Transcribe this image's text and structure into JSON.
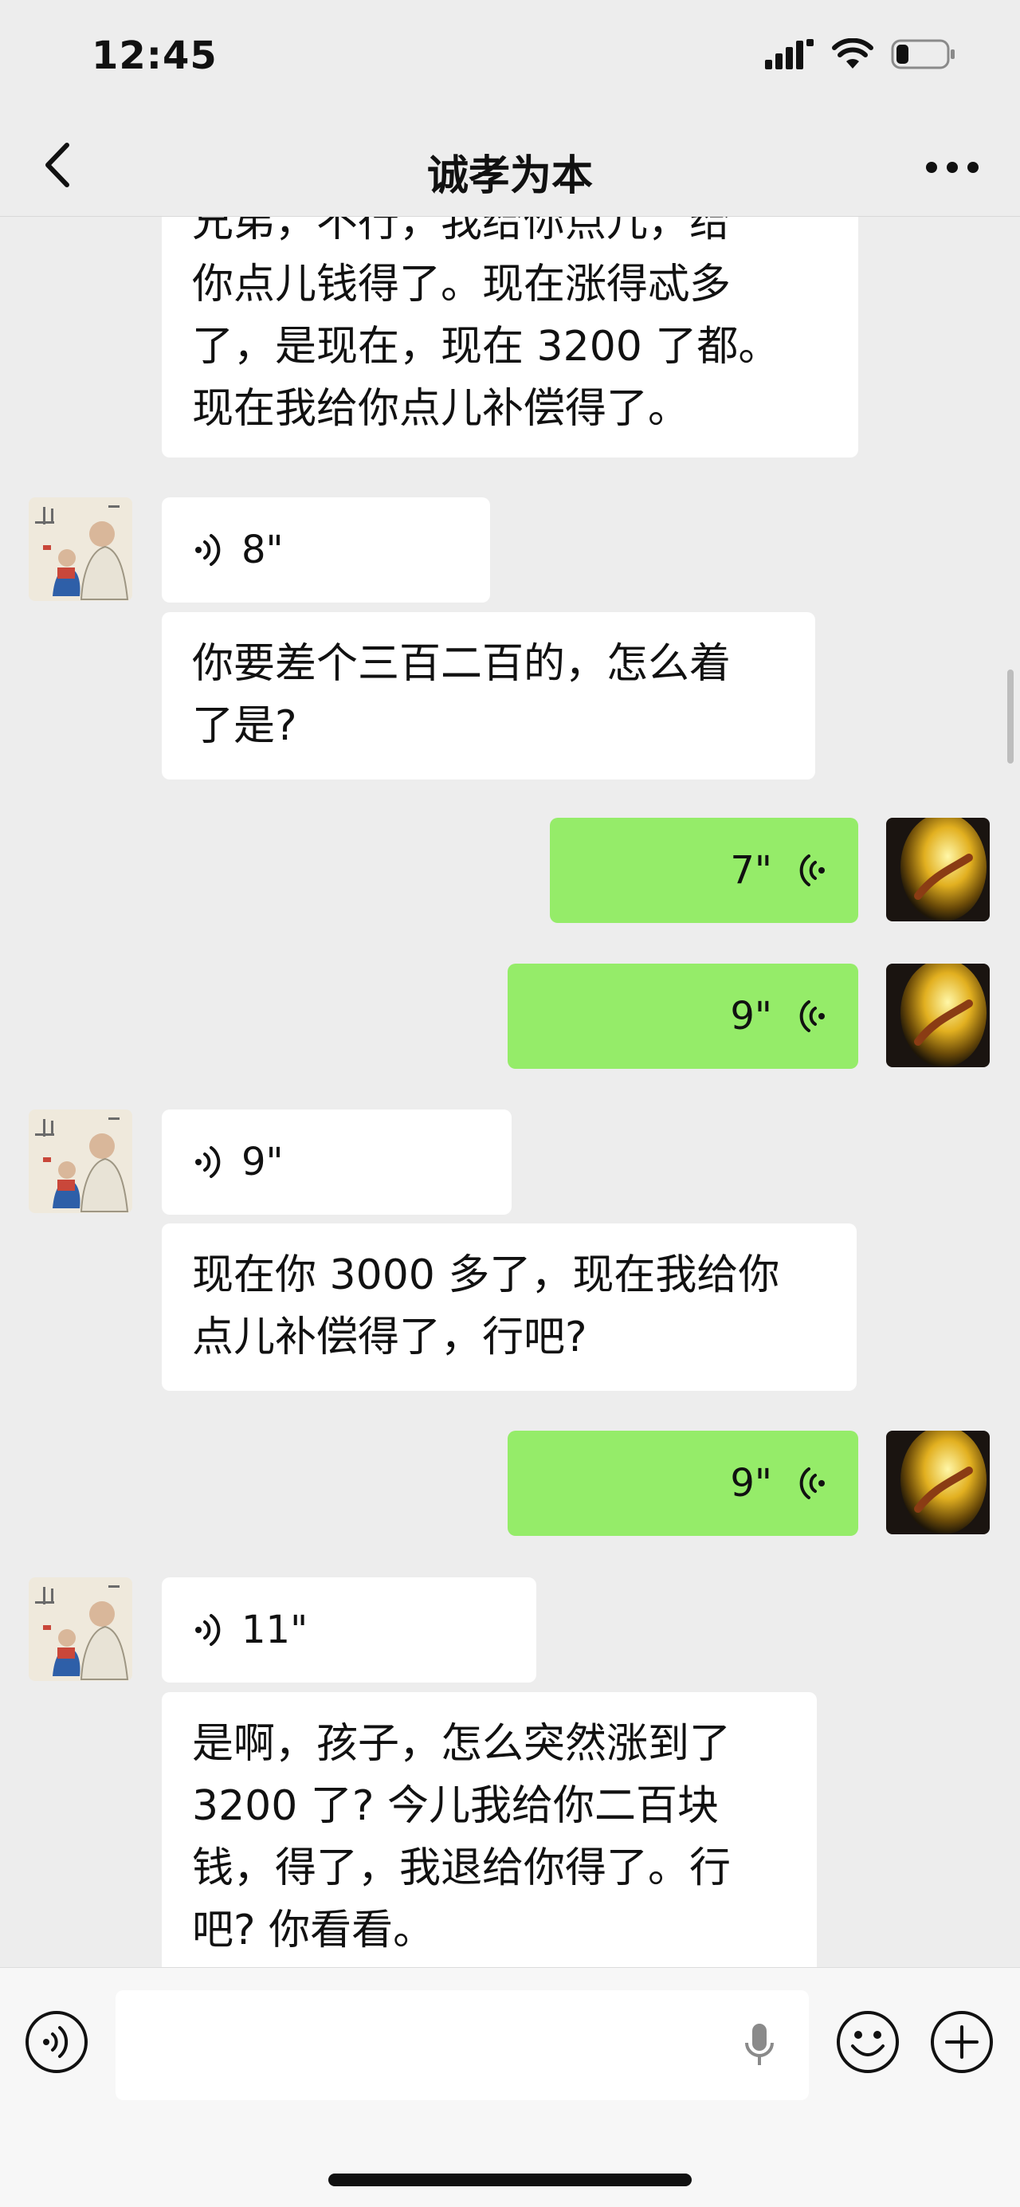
{
  "status_bar": {
    "time": "12:45",
    "battery_level": 0.25
  },
  "header": {
    "title": "诚孝为本"
  },
  "messages": [
    {
      "id": "m1",
      "side": "left",
      "type": "text",
      "text": "兄弟，不行，我给你点儿，给\n你点儿钱得了。现在涨得忒多\n了，是现在，现在 3200 了都。\n现在我给你点儿补偿得了。"
    },
    {
      "id": "m2",
      "side": "left",
      "type": "voice",
      "duration": "8\""
    },
    {
      "id": "m3",
      "side": "left",
      "type": "text",
      "text": "你要差个三百二百的，怎么着\n了是?"
    },
    {
      "id": "m4",
      "side": "right",
      "type": "voice",
      "duration": "7\""
    },
    {
      "id": "m5",
      "side": "right",
      "type": "voice",
      "duration": "9\""
    },
    {
      "id": "m6",
      "side": "left",
      "type": "voice",
      "duration": "9\""
    },
    {
      "id": "m7",
      "side": "left",
      "type": "text",
      "text": "现在你 3000 多了，现在我给你\n点儿补偿得了，行吧?"
    },
    {
      "id": "m8",
      "side": "right",
      "type": "voice",
      "duration": "9\""
    },
    {
      "id": "m9",
      "side": "left",
      "type": "voice",
      "duration": "11\""
    },
    {
      "id": "m10",
      "side": "left",
      "type": "text",
      "text": "是啊，孩子，怎么突然涨到了\n3200 了? 今儿我给你二百块\n钱，得了，我退给你得了。行\n吧? 你看看。"
    }
  ],
  "input_bar": {
    "voice_mode_icon": "voice-mode-icon",
    "mic_icon": "microphone-icon",
    "emoji_icon": "emoji-icon",
    "plus_icon": "plus-icon"
  },
  "colors": {
    "background": "#ededed",
    "sent_bubble": "#95ec69",
    "received_bubble": "#ffffff"
  }
}
